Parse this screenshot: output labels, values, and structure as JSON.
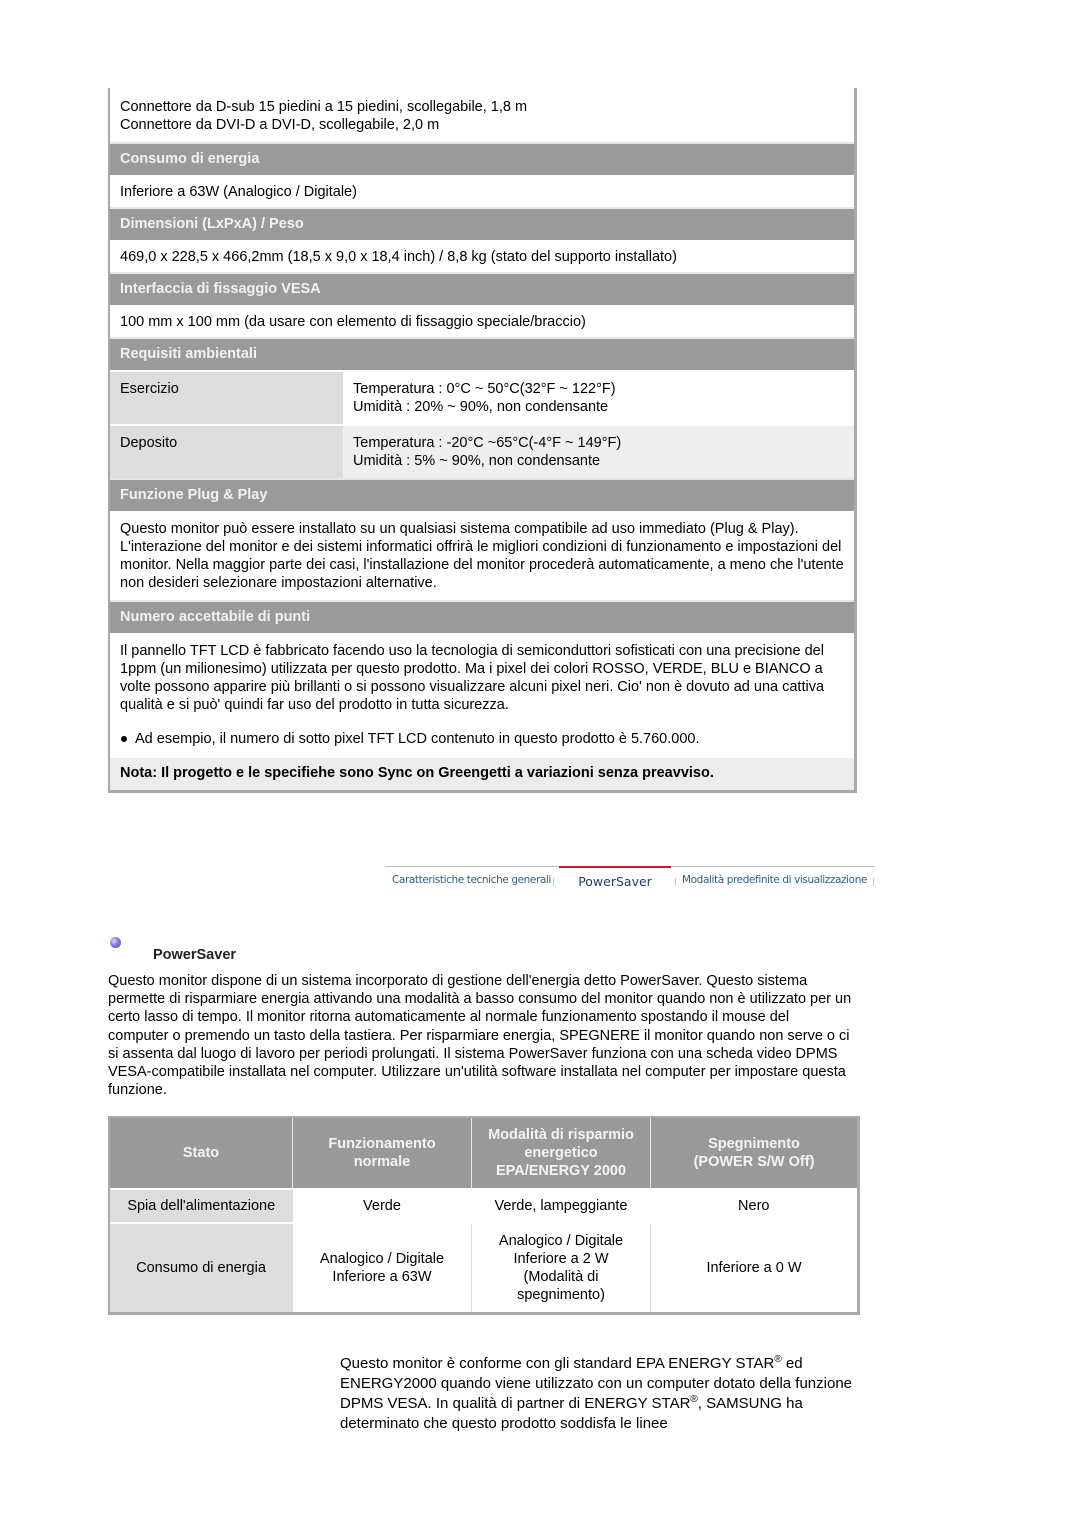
{
  "specs": {
    "cables": [
      "Connettore da D-sub 15 piedini a 15 piedini, scollegabile, 1,8 m",
      "Connettore da DVI-D a DVI-D, scollegabile, 2,0 m"
    ],
    "power_consumption": {
      "title": "Consumo di energia",
      "value": "Inferiore a 63W (Analogico / Digitale)"
    },
    "dimensions": {
      "title": "Dimensioni (LxPxA) / Peso",
      "value": "469,0 x 228,5 x 466,2mm (18,5 x 9,0 x 18,4 inch) / 8,8 kg (stato del supporto installato)"
    },
    "vesa": {
      "title": "Interfaccia di fissaggio VESA",
      "value": "100 mm x 100 mm (da usare con elemento di fissaggio speciale/braccio)"
    },
    "environment": {
      "title": "Requisiti ambientali",
      "rows": [
        {
          "label": "Esercizio",
          "temperature": "Temperatura : 0°C ~ 50°C(32°F ~ 122°F)",
          "humidity": "Umidità : 20% ~ 90%, non condensante"
        },
        {
          "label": "Deposito",
          "temperature": "Temperatura : -20°C ~65°C(-4°F ~ 149°F)",
          "humidity": "Umidità : 5% ~ 90%, non condensante"
        }
      ]
    },
    "plug_play": {
      "title": "Funzione Plug & Play",
      "text": "Questo monitor può essere installato su un qualsiasi sistema compatibile ad uso immediato (Plug & Play). L'interazione del monitor e dei sistemi informatici offrirà le migliori condizioni di funzionamento e impostazioni del monitor. Nella maggior parte dei casi, l'installazione del monitor procederà automaticamente, a meno che l'utente non desideri selezionare impostazioni alternative."
    },
    "pixels": {
      "title": "Numero accettabile di punti",
      "text": "Il pannello TFT LCD è fabbricato facendo uso la tecnologia di semiconduttori sofisticati con una precisione del 1ppm (un milionesimo) utilizzata per questo prodotto. Ma i pixel dei colori ROSSO, VERDE, BLU e BIANCO a volte possono apparire più brillanti o si possono visualizzare alcuni pixel neri. Cio' non è dovuto ad una cattiva qualità e si può' quindi far uso del prodotto in tutta sicurezza.",
      "bullet": "Ad esempio, il numero di sotto pixel TFT LCD contenuto in questo prodotto è 5.760.000."
    },
    "note": "Nota: Il progetto e le specifiehe sono Sync on Greengetti a variazioni senza preavviso."
  },
  "nav": {
    "tabs": [
      {
        "label": "Caratteristiche tecniche generali",
        "active": false
      },
      {
        "label": "PowerSaver",
        "active": true
      },
      {
        "label": "Modalità predefinite di visualizzazione",
        "active": false
      }
    ],
    "active_color": "#b2242c"
  },
  "powersaver": {
    "title": "PowerSaver",
    "text": "Questo monitor dispone di un sistema incorporato di gestione dell'energia detto PowerSaver. Questo sistema permette di risparmiare energia attivando una modalità a basso consumo del monitor quando non è utilizzato per un certo lasso di tempo. Il monitor ritorna automaticamente al normale funzionamento spostando il mouse del computer o premendo un tasto della tastiera. Per risparmiare energia, SPEGNERE il monitor quando non serve o ci si assenta dal luogo di lavoro per periodi prolungati. Il sistema PowerSaver funziona con una scheda video DPMS VESA-compatibile installata nel computer. Utilizzare un'utilità software installata nel computer per impostare questa funzione.",
    "table": {
      "headers": [
        [
          "Stato"
        ],
        [
          "Funzionamento",
          "normale"
        ],
        [
          "Modalità di risparmio",
          "energetico",
          "EPA/ENERGY 2000"
        ],
        [
          "Spegnimento",
          "(POWER S/W Off)"
        ]
      ],
      "rows": [
        {
          "label": "Spia dell'alimentazione",
          "cells": [
            [
              "Verde"
            ],
            [
              "Verde, lampeggiante"
            ],
            [
              "Nero"
            ]
          ]
        },
        {
          "label": "Consumo di energia",
          "cells": [
            [
              "Analogico / Digitale",
              "Inferiore a 63W"
            ],
            [
              "Analogico / Digitale",
              "Inferiore a 2 W",
              "(Modalità di",
              "spegnimento)"
            ],
            [
              "Inferiore a 0 W"
            ]
          ]
        }
      ]
    }
  },
  "compliance": {
    "line1_a": "Questo monitor è conforme con gli standard EPA ENERGY STAR",
    "line1_b": " ed ENERGY2000 quando viene utilizzato con un computer dotato della funzione DPMS VESA. In qualità di partner di ENERGY STAR",
    "line1_c": ", SAMSUNG ha determinato che questo prodotto soddisfa le linee",
    "registered": "®"
  }
}
